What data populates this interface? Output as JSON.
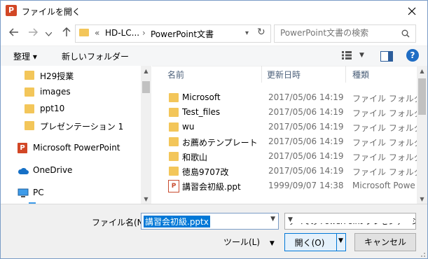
{
  "window": {
    "title": "ファイルを開く",
    "app_icon": "P"
  },
  "address": {
    "prefix": "«",
    "segment1": "HD-LC...",
    "segment2": "PowerPoint文書"
  },
  "search": {
    "placeholder": "PowerPoint文書の検索"
  },
  "toolbar": {
    "organize": "整理 ▾",
    "new_folder": "新しいフォルダー",
    "help": "?"
  },
  "nav": {
    "folders": [
      "H29授業",
      "images",
      "ppt10",
      "プレゼンテーション 1"
    ],
    "ppt": "Microsoft PowerPoint",
    "onedrive": "OneDrive",
    "pc": "PC"
  },
  "files": {
    "headers": {
      "name": "名前",
      "date": "更新日時",
      "type": "種類"
    },
    "rows": [
      {
        "name": "Microsoft",
        "date": "2017/05/06 14:19",
        "type": "ファイル フォルダー",
        "kind": "folder"
      },
      {
        "name": "Test_files",
        "date": "2017/05/06 14:19",
        "type": "ファイル フォルダー",
        "kind": "folder"
      },
      {
        "name": "wu",
        "date": "2017/05/06 14:19",
        "type": "ファイル フォルダー",
        "kind": "folder"
      },
      {
        "name": "お薦めテンプレート",
        "date": "2017/05/06 14:19",
        "type": "ファイル フォルダー",
        "kind": "folder"
      },
      {
        "name": "和歌山",
        "date": "2017/05/06 14:19",
        "type": "ファイル フォルダー",
        "kind": "folder"
      },
      {
        "name": "徳島9707改",
        "date": "2017/05/06 14:19",
        "type": "ファイル フォルダー",
        "kind": "folder"
      },
      {
        "name": "講習会初級.ppt",
        "date": "1999/09/07 14:38",
        "type": "Microsoft Powe",
        "kind": "ppt"
      }
    ]
  },
  "bottom": {
    "filename_label": "ファイル名(N):",
    "filename_value": "講習会初級.pptx",
    "filetype": "すべての PowerPoint プレゼンテーション",
    "tools": "ツール(L)",
    "open": "開く(O)",
    "cancel": "キャンセル"
  }
}
